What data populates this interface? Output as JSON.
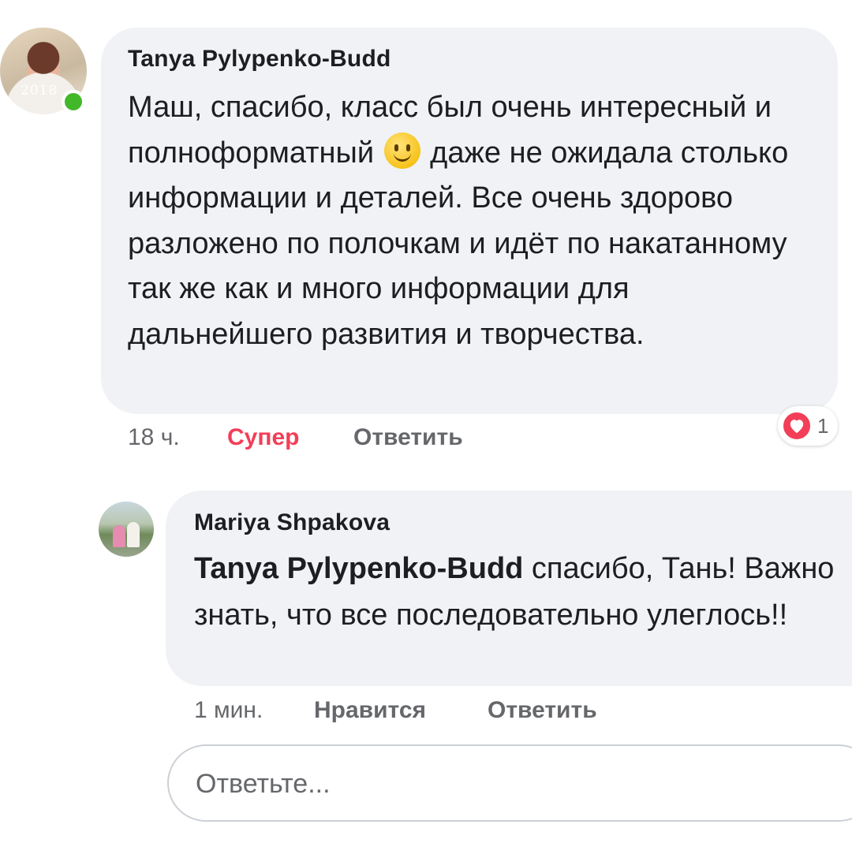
{
  "comment": {
    "author": "Tanya Pylypenko-Budd",
    "avatar_year": "2018",
    "text_before_emoji": "Маш, спасибо, класс был очень интересный и полноформатный ",
    "emoji": "slightly-smiling-face",
    "text_after_emoji": " даже не ожидала столько информации и деталей. Все очень здорово разложено по полочкам и идёт по накатанному так же как и много информации для дальнейшего развития и творчества.",
    "time": "18 ч.",
    "reaction_label": "Супер",
    "reply_label": "Ответить",
    "reaction_count": "1",
    "reaction_icon": "heart-icon",
    "online": true
  },
  "reply": {
    "author": "Mariya Shpakova",
    "mention": "Tanya Pylypenko-Budd",
    "text": " спасибо, Тань! Важно знать, что все последовательно улеглось!!",
    "time": "1 мин.",
    "like_label": "Нравится",
    "reply_label": "Ответить"
  },
  "composer": {
    "placeholder": "Ответьте..."
  },
  "colors": {
    "bubble": "#f0f2f5",
    "text": "#1c1e21",
    "secondary": "#65676b",
    "love": "#f33e58",
    "online": "#42b72a"
  }
}
